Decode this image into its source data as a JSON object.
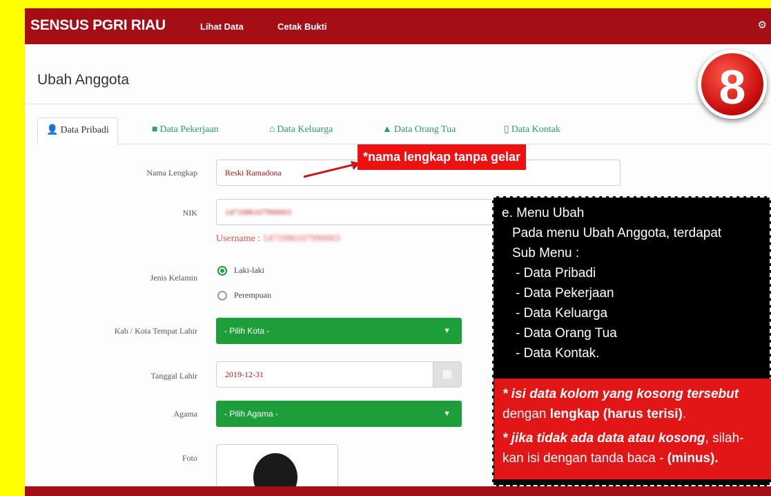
{
  "navbar": {
    "brand": "SENSUS PGRI RIAU",
    "links": [
      "Lihat Data",
      "Cetak Bukti"
    ],
    "settings_icon": "gear-icon"
  },
  "page": {
    "heading": "Ubah Anggota",
    "step_badge": "8"
  },
  "tabs": [
    {
      "label": "Data Pribadi",
      "icon": "user-icon",
      "active": true
    },
    {
      "label": "Data Pekerjaan",
      "icon": "book-icon"
    },
    {
      "label": "Data Keluarga",
      "icon": "home-icon"
    },
    {
      "label": "Data Orang Tua",
      "icon": "tree-icon"
    },
    {
      "label": "Data Kontak",
      "icon": "phone-icon"
    }
  ],
  "form": {
    "nama_label": "Nama Lengkap",
    "nama_value": "Reski Ramadona",
    "nik_label": "NIK",
    "nik_value": "1471086107990003",
    "username_label": "Username :",
    "username_value": "1471086107990003",
    "jk_label": "Jenis Kelamin",
    "jk_options": [
      "Laki-laki",
      "Perempuan"
    ],
    "kota_label": "Kab / Kota Tempat Lahir",
    "kota_value": "- Pilih Kota -",
    "tgl_label": "Tanggal Lahir",
    "tgl_value": "2019-12-31",
    "agama_label": "Agama",
    "agama_value": "- Pilih Agama -",
    "foto_label": "Foto"
  },
  "annotations": {
    "arrow_tag": "*nama lengkap tanpa gelar",
    "menu_title": "e. Menu Ubah",
    "menu_desc_1": "Pada menu Ubah Anggota, terdapat",
    "menu_desc_2": "Sub Menu :",
    "menu_items": [
      "- Data Pribadi",
      "- Data Pekerjaan",
      "- Data Keluarga",
      "- Data Orang Tua",
      "- Data Kontak."
    ],
    "note1_italic": "* isi data kolom yang kosong tersebut",
    "note1_a": "dengan ",
    "note1_b": "lengkap (harus terisi)",
    "note1_c": ".",
    "note2_italic": "* jika tidak ada data atau kosong",
    "note2_a": ", silah-",
    "note2_b": "kan isi dengan tanda baca - ",
    "note2_c": "(minus)."
  },
  "colors": {
    "navbar": "#a60e16",
    "accent_green": "#1e9e3a",
    "annotation_red": "#ee1111",
    "background": "#ffff00"
  }
}
